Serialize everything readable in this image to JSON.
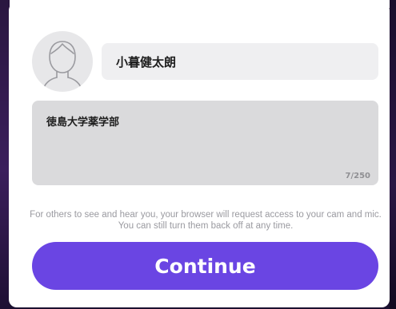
{
  "profile": {
    "avatar_icon": "user-outline-icon",
    "name_value": "小暮健太朗",
    "bio_value": "徳島大学薬学部",
    "bio_counter": "7/250"
  },
  "notice": {
    "text": "For others to see and hear you, your browser will request access to your cam and mic. You can still turn them back off at any time."
  },
  "actions": {
    "continue_label": "Continue"
  },
  "colors": {
    "accent": "#6a45e3",
    "input_light": "#efeff1",
    "input_dark": "#dadadc",
    "muted_text": "#9a9aa0"
  }
}
